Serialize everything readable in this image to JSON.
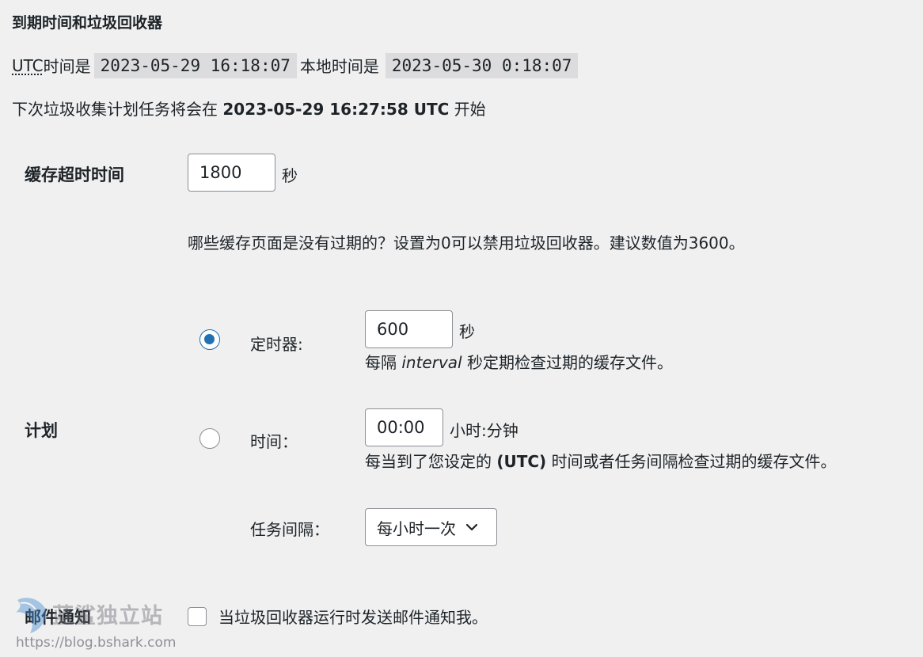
{
  "section": {
    "title": "到期时间和垃圾回收器"
  },
  "time_info": {
    "utc_abbr": "UTC",
    "utc_label_suffix": "时间是",
    "utc_time": "2023-05-29 16:18:07",
    "local_label": "本地时间是",
    "local_time": "2023-05-30 0:18:07"
  },
  "next_gc": {
    "prefix": "下次垃圾收集计划任务将会在",
    "datetime": "2023-05-29 16:27:58 UTC",
    "suffix": "开始"
  },
  "cache_timeout": {
    "label": "缓存超时时间",
    "value": "1800",
    "unit": "秒",
    "description": "哪些缓存页面是没有过期的？设置为0可以禁用垃圾回收器。建议数值为3600。"
  },
  "schedule": {
    "label": "计划",
    "timer": {
      "label": "定时器:",
      "value": "600",
      "unit": "秒",
      "desc_prefix": "每隔",
      "desc_em": "interval",
      "desc_suffix": "秒定期检查过期的缓存文件。",
      "checked": true
    },
    "clock": {
      "label": "时间：",
      "value": "00:00",
      "unit": "小时:分钟",
      "desc_prefix": "每当到了您设定的",
      "desc_bold": "(UTC)",
      "desc_suffix": "时间或者任务间隔检查过期的缓存文件。",
      "checked": false
    },
    "interval": {
      "label": "任务间隔：",
      "selected": "每小时一次"
    }
  },
  "email": {
    "label": "邮件通知",
    "checkbox_label": "当垃圾回收器运行时发送邮件通知我。"
  },
  "watermark": {
    "name": "蓝鲨独立站",
    "url": "https://blog.bshark.com"
  },
  "colors": {
    "accent": "#2271b1",
    "background": "#f0f0f1",
    "code_bg": "#dcdcde",
    "border": "#8c8f94"
  }
}
